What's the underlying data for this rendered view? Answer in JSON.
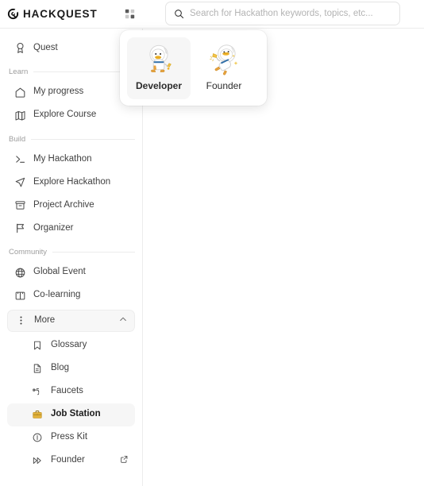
{
  "header": {
    "brand_name": "HACKQUEST",
    "brand_icon": "hackquest-logo-icon",
    "grid_icon": "grid-apps-icon",
    "search": {
      "icon": "search-icon",
      "placeholder": "Search for Hackathon keywords, topics, etc...",
      "value": ""
    }
  },
  "role_panel": {
    "options": [
      {
        "label": "Developer",
        "icon": "duck-astronaut-developer-icon",
        "selected": true
      },
      {
        "label": "Founder",
        "icon": "duck-astronaut-founder-icon",
        "selected": false
      }
    ]
  },
  "sidebar": {
    "top_items": [
      {
        "label": "Quest",
        "icon": "medal-icon"
      }
    ],
    "sections": [
      {
        "title": "Learn",
        "items": [
          {
            "label": "My progress",
            "icon": "home-icon"
          },
          {
            "label": "Explore Course",
            "icon": "map-icon"
          }
        ]
      },
      {
        "title": "Build",
        "items": [
          {
            "label": "My Hackathon",
            "icon": "terminal-icon"
          },
          {
            "label": "Explore Hackathon",
            "icon": "navigation-arrow-icon"
          },
          {
            "label": "Project Archive",
            "icon": "archive-box-icon"
          },
          {
            "label": "Organizer",
            "icon": "flag-icon"
          }
        ]
      },
      {
        "title": "Community",
        "items": [
          {
            "label": "Global Event",
            "icon": "globe-icon"
          },
          {
            "label": "Co-learning",
            "icon": "open-book-icon"
          }
        ]
      }
    ],
    "more": {
      "label": "More",
      "icon": "vertical-dots-icon",
      "chevron_icon": "chevron-up-icon",
      "expanded": true,
      "sub_items": [
        {
          "label": "Glossary",
          "icon": "bookmark-icon",
          "active": false,
          "external": false
        },
        {
          "label": "Blog",
          "icon": "document-icon",
          "active": false,
          "external": false
        },
        {
          "label": "Faucets",
          "icon": "faucet-icon",
          "active": false,
          "external": false
        },
        {
          "label": "Job Station",
          "icon": "briefcase-icon",
          "active": true,
          "external": false
        },
        {
          "label": "Press Kit",
          "icon": "info-circle-icon",
          "active": false,
          "external": false
        },
        {
          "label": "Founder",
          "icon": "double-arrow-icon",
          "active": false,
          "external": true,
          "external_icon": "external-link-icon"
        }
      ]
    }
  },
  "colors": {
    "accent_gold": "#E3B23C",
    "text_primary": "#3f3f3f",
    "text_muted": "#9d9d9d",
    "border": "#ececec",
    "active_bg": "#f6f6f6"
  }
}
